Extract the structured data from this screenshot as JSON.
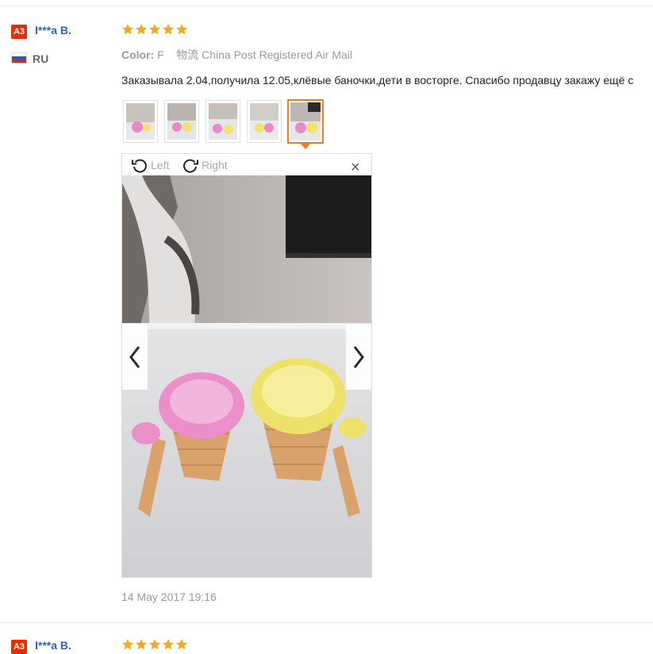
{
  "reviews": [
    {
      "badge": "A3",
      "user": "I***a B.",
      "country": "RU",
      "stars": 5,
      "color_label": "Color:",
      "color_value": "F",
      "shipping": "物流 China Post Registered Air Mail",
      "text": "Заказывала 2.04,получила 12.05,клёвые баночки,дети в восторге. Спасибо продавцу закажу ещё с",
      "date": "14 May 2017 19:16"
    },
    {
      "badge": "A3",
      "user": "I***a B.",
      "stars": 5
    }
  ],
  "viewer": {
    "left_label": "Left",
    "right_label": "Right",
    "close_label": "×"
  },
  "colors": {
    "accent": "#f07c21",
    "star": "#f5a623",
    "badge": "#e62e04",
    "link": "#2a64c5"
  }
}
